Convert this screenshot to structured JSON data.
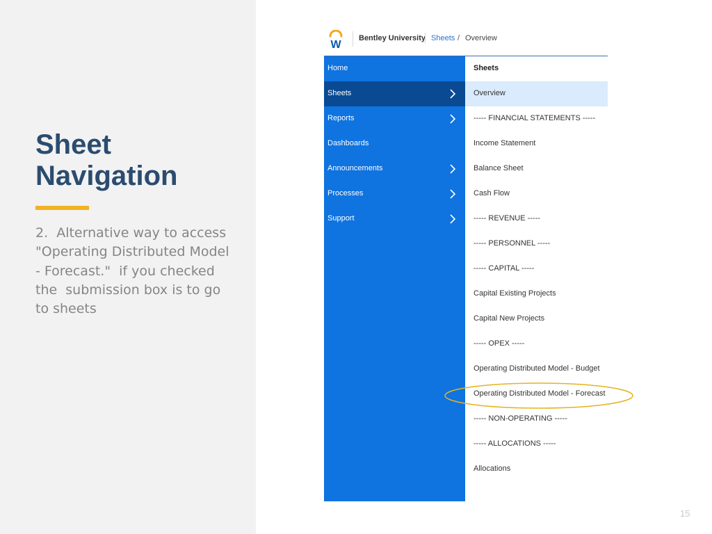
{
  "slide": {
    "title": "Sheet Navigation",
    "body": "2.  Alternative way to access \"Operating Distributed Model - Forecast.\"  if you checked the  submission box is to go to sheets",
    "page_number": "15"
  },
  "header": {
    "tenant": "Bentley University",
    "breadcrumb": [
      "Sheets",
      "/",
      "Overview"
    ],
    "logo_colors": {
      "arc": "#f2a81d",
      "letter": "#0a5cad"
    }
  },
  "nav": {
    "items": [
      {
        "label": "Home",
        "has_chevron": false,
        "active": false
      },
      {
        "label": "Sheets",
        "has_chevron": true,
        "active": true
      },
      {
        "label": "Reports",
        "has_chevron": true,
        "active": false
      },
      {
        "label": "Dashboards",
        "has_chevron": false,
        "active": false
      },
      {
        "label": "Announcements",
        "has_chevron": true,
        "active": false
      },
      {
        "label": "Processes",
        "has_chevron": true,
        "active": false
      },
      {
        "label": "Support",
        "has_chevron": true,
        "active": false
      }
    ],
    "chevron_icon": "chevron-right-icon"
  },
  "submenu": {
    "heading": "Sheets",
    "items": [
      {
        "label": "Overview",
        "selected": true
      },
      {
        "label": "----- FINANCIAL STATEMENTS -----"
      },
      {
        "label": "Income Statement"
      },
      {
        "label": "Balance Sheet"
      },
      {
        "label": "Cash Flow"
      },
      {
        "label": "----- REVENUE -----"
      },
      {
        "label": "----- PERSONNEL -----"
      },
      {
        "label": "----- CAPITAL -----"
      },
      {
        "label": "Capital Existing Projects"
      },
      {
        "label": "Capital New Projects"
      },
      {
        "label": "----- OPEX -----"
      },
      {
        "label": "Operating Distributed Model - Budget"
      },
      {
        "label": "Operating Distributed Model - Forecast",
        "highlighted": true
      },
      {
        "label": "----- NON-OPERATING -----"
      },
      {
        "label": "----- ALLOCATIONS -----"
      },
      {
        "label": "Allocations"
      }
    ]
  },
  "colors": {
    "nav_bg": "#0f73e0",
    "nav_active_bg": "#0a4a93",
    "submenu_selected_bg": "#d9ebfd",
    "highlight_oval": "#e7b21c",
    "title": "#2b4c6f",
    "accent": "#f2b222"
  }
}
